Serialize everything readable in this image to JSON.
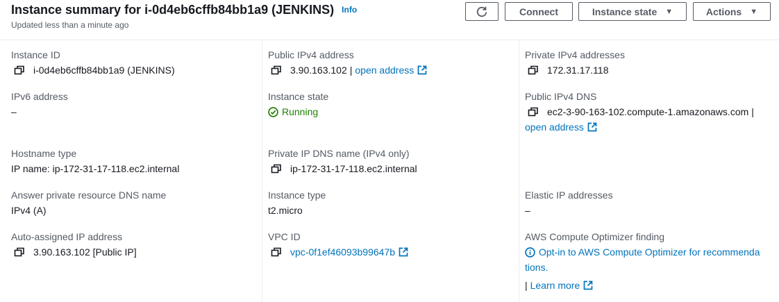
{
  "header": {
    "title": "Instance summary for i-0d4eb6cffb84bb1a9 (JENKINS)",
    "info_label": "Info",
    "subtitle": "Updated less than a minute ago",
    "connect_label": "Connect",
    "instance_state_label": "Instance state",
    "actions_label": "Actions"
  },
  "col1": {
    "instance_id_label": "Instance ID",
    "instance_id_value": "i-0d4eb6cffb84bb1a9 (JENKINS)",
    "ipv6_label": "IPv6 address",
    "ipv6_value": "–",
    "hostname_type_label": "Hostname type",
    "hostname_type_value": "IP name: ip-172-31-17-118.ec2.internal",
    "answer_dns_label": "Answer private resource DNS name",
    "answer_dns_value": "IPv4 (A)",
    "auto_ip_label": "Auto-assigned IP address",
    "auto_ip_value": "3.90.163.102 [Public IP]"
  },
  "col2": {
    "public_ipv4_label": "Public IPv4 address",
    "public_ipv4_value": "3.90.163.102",
    "public_ipv4_sep": "|",
    "public_ipv4_link": "open address",
    "instance_state_label": "Instance state",
    "instance_state_value": "Running",
    "private_dns_label": "Private IP DNS name (IPv4 only)",
    "private_dns_value": "ip-172-31-17-118.ec2.internal",
    "instance_type_label": "Instance type",
    "instance_type_value": "t2.micro",
    "vpc_label": "VPC ID",
    "vpc_value": "vpc-0f1ef46093b99647b"
  },
  "col3": {
    "private_ipv4_label": "Private IPv4 addresses",
    "private_ipv4_value": "172.31.17.118",
    "public_dns_label": "Public IPv4 DNS",
    "public_dns_value": "ec2-3-90-163-102.compute-1.amazonaws.com",
    "public_dns_sep": "|",
    "public_dns_link": "open address",
    "elastic_label": "Elastic IP addresses",
    "elastic_value": "–",
    "optimizer_label": "AWS Compute Optimizer finding",
    "optimizer_link_line1": "Opt-in to AWS Compute Optimizer for recommenda",
    "optimizer_link_line2": "tions.",
    "optimizer_sep": "|",
    "learn_more": "Learn more"
  },
  "icons": {
    "refresh": "refresh-icon",
    "copy": "copy-icon",
    "external": "external-link-icon",
    "running": "check-circle-icon",
    "info": "info-circle-icon",
    "caret": "caret-down-icon"
  },
  "colors": {
    "link": "#0073bb",
    "running": "#1d8102",
    "label": "#545b64",
    "text": "#16191f"
  }
}
